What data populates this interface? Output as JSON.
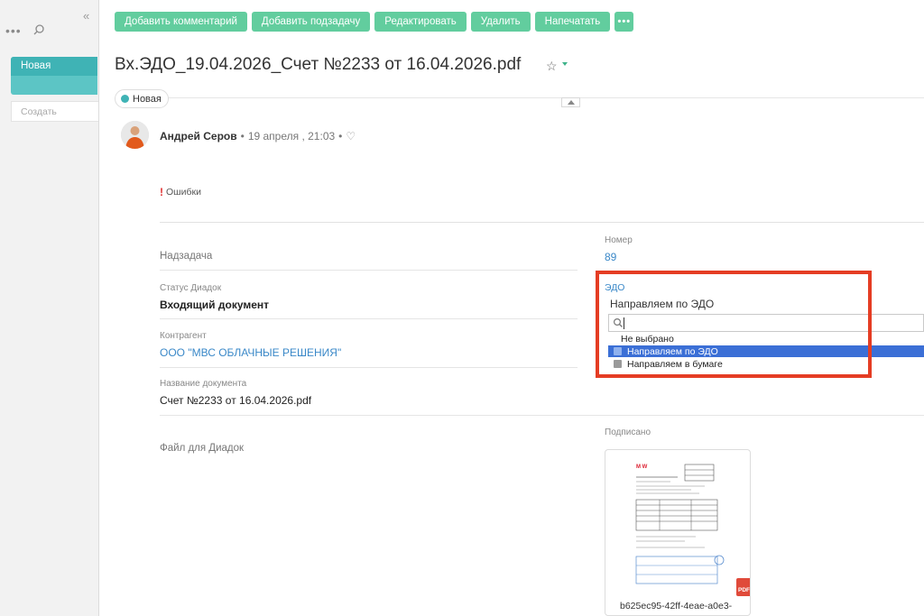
{
  "sidebar": {
    "collapse_glyph": "«",
    "dots_glyph": "•••",
    "item_label": "Новая",
    "create_placeholder": "Создать",
    "colors": {
      "item": "#3fb3b5",
      "item_light": "#5cc5c5"
    }
  },
  "toolbar": {
    "buttons": [
      "Добавить комментарий",
      "Добавить подзадачу",
      "Редактировать",
      "Удалить",
      "Напечатать"
    ],
    "more_glyph": "•••",
    "color": "#62cd9e"
  },
  "task": {
    "title": "Вх.ЭДО_19.04.2026_Счет №2233 от 16.04.2026.pdf",
    "star_glyph": "☆",
    "status": "Новая",
    "status_color": "#3fb3b5"
  },
  "author": {
    "name": "Андрей Серов",
    "sep": "•",
    "date": "19 апреля , 21:03",
    "heart_glyph": "♡"
  },
  "errors": {
    "mark": "!",
    "label": "Ошибки"
  },
  "fields": {
    "parent_task_label": "Надзадача",
    "number_label": "Номер",
    "number_value": "89",
    "diadoc_status_label": "Статус Диадок",
    "diadoc_status_value": "Входящий документ",
    "counterparty_label": "Контрагент",
    "counterparty_value": "ООО \"МВС ОБЛАЧНЫЕ РЕШЕНИЯ\"",
    "doc_name_label": "Название документа",
    "doc_name_value": "Счет №2233 от 16.04.2026.pdf",
    "diadoc_file_label": "Файл для Диадок"
  },
  "edo": {
    "label": "ЭДО",
    "current": "Направляем по ЭДО",
    "search_value": "",
    "options": [
      {
        "label": "Не выбрано",
        "color": "",
        "selected": false
      },
      {
        "label": "Направляем по ЭДО",
        "color": "#8fb1ee",
        "selected": true
      },
      {
        "label": "Направляем в бумаге",
        "color": "#9a9a9a",
        "selected": false
      }
    ],
    "highlight_color": "#e53d24"
  },
  "attachment": {
    "label": "Подписано",
    "file_name": "b625ec95-42ff-4eae-a0e3-",
    "badge": "PDF",
    "badge_color": "#e04a3a"
  }
}
